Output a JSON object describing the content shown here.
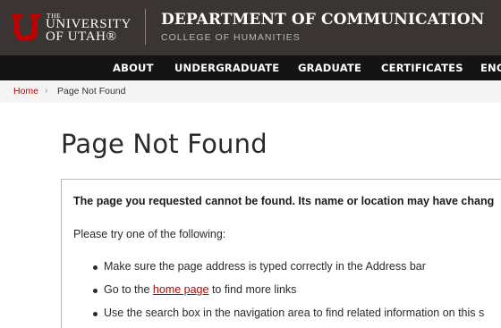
{
  "header": {
    "university_the": "THE",
    "university_line1": "UNIVERSITY",
    "university_line2": "OF UTAH®",
    "department": "DEPARTMENT OF COMMUNICATION",
    "college": "COLLEGE OF HUMANITIES",
    "brand_color": "#be0000"
  },
  "nav": {
    "items": [
      "ABOUT",
      "UNDERGRADUATE",
      "GRADUATE",
      "CERTIFICATES",
      "ENC"
    ]
  },
  "breadcrumb": {
    "home": "Home",
    "separator": "›",
    "current": "Page Not Found"
  },
  "main": {
    "title": "Page Not Found",
    "lead": "The page you requested cannot be found. Its name or location may have chang",
    "intro": "Please try one of the following:",
    "items": [
      {
        "text": "Make sure the page address is typed correctly in the Address bar"
      },
      {
        "before": "Go to the ",
        "link": "home page",
        "after": " to find more links"
      },
      {
        "text": "Use the search box in the navigation area to find related information on this s"
      }
    ]
  }
}
